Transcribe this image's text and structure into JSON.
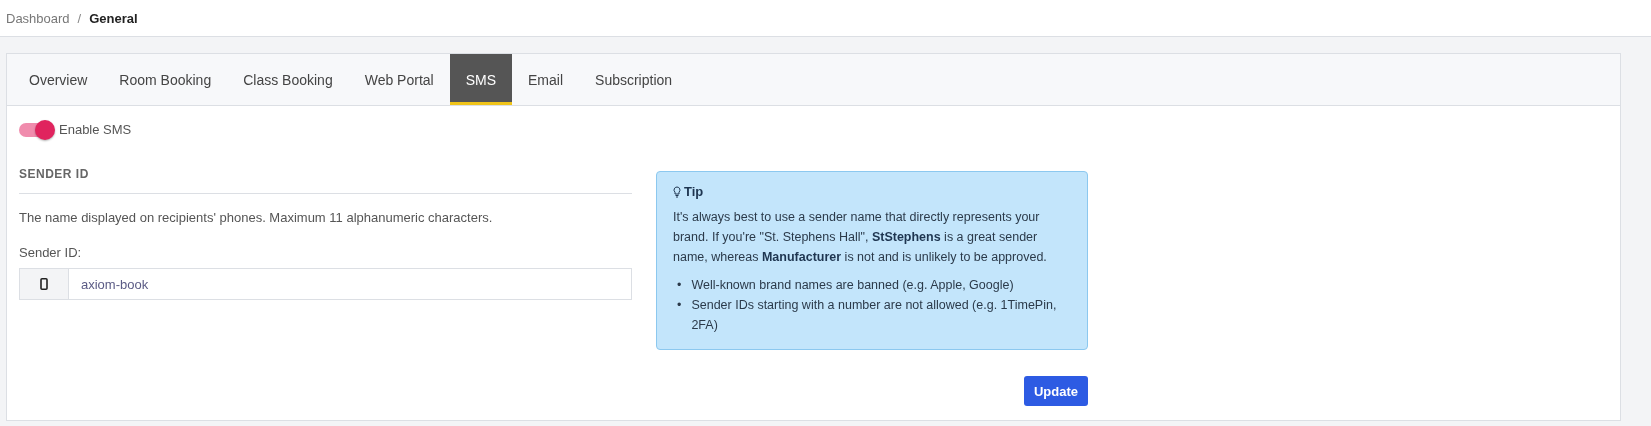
{
  "breadcrumb": [
    {
      "label": "Dashboard",
      "current": false
    },
    {
      "label": "General",
      "current": true
    }
  ],
  "breadcrumb_separator": "/",
  "tabs": [
    {
      "label": "Overview",
      "selected": false
    },
    {
      "label": "Room Booking",
      "selected": false
    },
    {
      "label": "Class Booking",
      "selected": false
    },
    {
      "label": "Web Portal",
      "selected": false
    },
    {
      "label": "SMS",
      "selected": true
    },
    {
      "label": "Email",
      "selected": false
    },
    {
      "label": "Subscription",
      "selected": false
    }
  ],
  "enable_toggle": {
    "label": "Enable SMS",
    "on": true
  },
  "section_title": "SENDER ID",
  "description": "The name displayed on recipients' phones. Maximum 11 alphanumeric characters.",
  "field": {
    "label": "Sender ID:",
    "value": "axiom-book"
  },
  "tip": {
    "title": "Tip",
    "text": "It's always best to use a sender name that directly represents your brand. If you're \"St. Stephens Hall\", **StStephens** is a great sender name, whereas **Manufacturer** is not and is unlikely to be approved.",
    "bullet_marker": "•",
    "bullets": [
      "Well-known brand names are banned (e.g. Apple, Google)",
      "Sender IDs starting with a number are not allowed (e.g. 1TimePin, 2FA)"
    ]
  },
  "buttons": [
    "Update"
  ]
}
